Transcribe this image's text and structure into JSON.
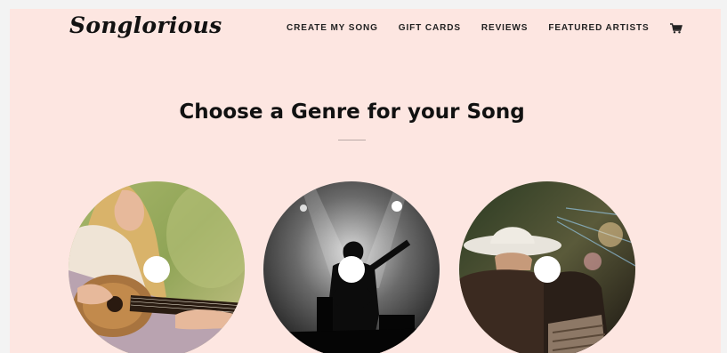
{
  "brand": {
    "logo_text": "Songlorious"
  },
  "nav": {
    "items": [
      "CREATE MY SONG",
      "GIFT CARDS",
      "REVIEWS",
      "FEATURED ARTISTS"
    ],
    "cart_icon": "cart-icon"
  },
  "main": {
    "heading": "Choose a Genre for your Song"
  },
  "genres": [
    {
      "image": "woman-with-acoustic-guitar",
      "icon": "vinyl-disc"
    },
    {
      "image": "guitarist-on-stage-black-white",
      "icon": "vinyl-disc"
    },
    {
      "image": "cowboy-hat-concert-crowd",
      "icon": "vinyl-disc"
    }
  ],
  "colors": {
    "page_background": "#fde6e1",
    "text": "#111111",
    "divider": "#b9a9a6"
  }
}
